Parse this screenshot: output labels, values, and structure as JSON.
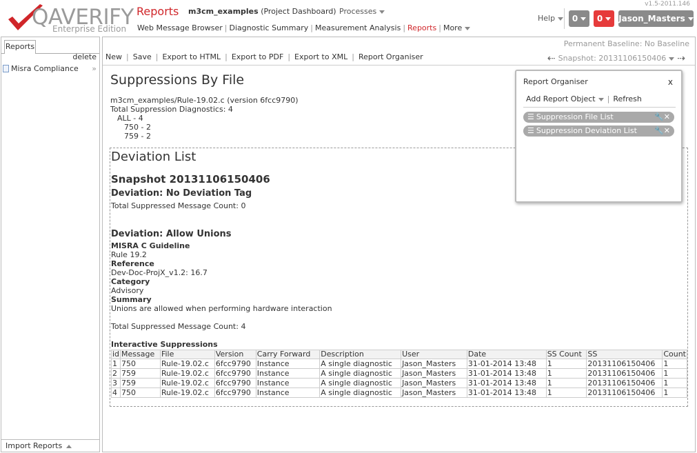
{
  "header": {
    "logo_text": "QAVERIFY",
    "logo_sub": "Enterprise Edition",
    "app_title": "Reports",
    "project_name": "m3cm_examples",
    "project_label": "(Project Dashboard)",
    "processes": "Processes",
    "version": "v1.5-2011.146",
    "help": "Help",
    "badge_gray": "0",
    "badge_red": "0",
    "user": "Jason_Masters",
    "nav": [
      "Web Message Browser",
      "Diagnostic Summary",
      "Measurement Analysis",
      "Reports",
      "More"
    ]
  },
  "sidebar": {
    "tab": "Reports",
    "delete": "delete",
    "item": "Misra Compliance",
    "import": "Import Reports"
  },
  "main": {
    "baseline": "Permanent Baseline: No Baseline",
    "toolbar": [
      "New",
      "Save",
      "Export to HTML",
      "Export to PDF",
      "Export to XML",
      "Report Organiser"
    ],
    "snapshot": "Snapshot: 20131106150406"
  },
  "report": {
    "title": "Suppressions By File",
    "file_line": "m3cm_examples/Rule-19.02.c (version 6fcc9790)",
    "total_line": "Total Suppression Diagnostics: 4",
    "all_line": "ALL - 4",
    "l750": "750 - 2",
    "l759": "759 - 2"
  },
  "deviation": {
    "title": "Deviation List",
    "snapshot": "Snapshot 20131106150406",
    "dev1_title": "Deviation: No Deviation Tag",
    "dev1_count": "Total Suppressed Message Count: 0",
    "dev2_title": "Deviation: Allow Unions",
    "misra_label": "MISRA C Guideline",
    "misra_value": "Rule 19.2",
    "ref_label": "Reference",
    "ref_value": "Dev-Doc-ProjX_v1.2: 16.7",
    "cat_label": "Category",
    "cat_value": "Advisory",
    "sum_label": "Summary",
    "sum_value": "Unions are allowed when performing hardware interaction",
    "dev2_count": "Total Suppressed Message Count: 4",
    "interactive_label": "Interactive Suppressions"
  },
  "table": {
    "headers": [
      "id",
      "Message",
      "File",
      "Version",
      "Carry Forward",
      "Description",
      "User",
      "Date",
      "SS Count",
      "SS",
      "Count"
    ],
    "rows": [
      [
        "1",
        "750",
        "Rule-19.02.c",
        "6fcc9790",
        "Instance",
        "A single diagnostic",
        "Jason_Masters",
        "31-01-2014  13:48",
        "1",
        "20131106150406",
        "1"
      ],
      [
        "2",
        "759",
        "Rule-19.02.c",
        "6fcc9790",
        "Instance",
        "A single diagnostic",
        "Jason_Masters",
        "31-01-2014  13:48",
        "1",
        "20131106150406",
        "1"
      ],
      [
        "3",
        "759",
        "Rule-19.02.c",
        "6fcc9790",
        "Instance",
        "A single diagnostic",
        "Jason_Masters",
        "31-01-2014  13:48",
        "1",
        "20131106150406",
        "1"
      ],
      [
        "4",
        "750",
        "Rule-19.02.c",
        "6fcc9790",
        "Instance",
        "A single diagnostic",
        "Jason_Masters",
        "31-01-2014  13:48",
        "1",
        "20131106150406",
        "1"
      ]
    ]
  },
  "organiser": {
    "title": "Report Organiser",
    "close": "x",
    "add": "Add Report Object",
    "refresh": "Refresh",
    "items": [
      "Suppression File List",
      "Suppression Deviation List"
    ]
  },
  "colors": {
    "accent_red": "#d0262a",
    "badge_gray": "#8a8a8a",
    "badge_red": "#e63b3b"
  }
}
